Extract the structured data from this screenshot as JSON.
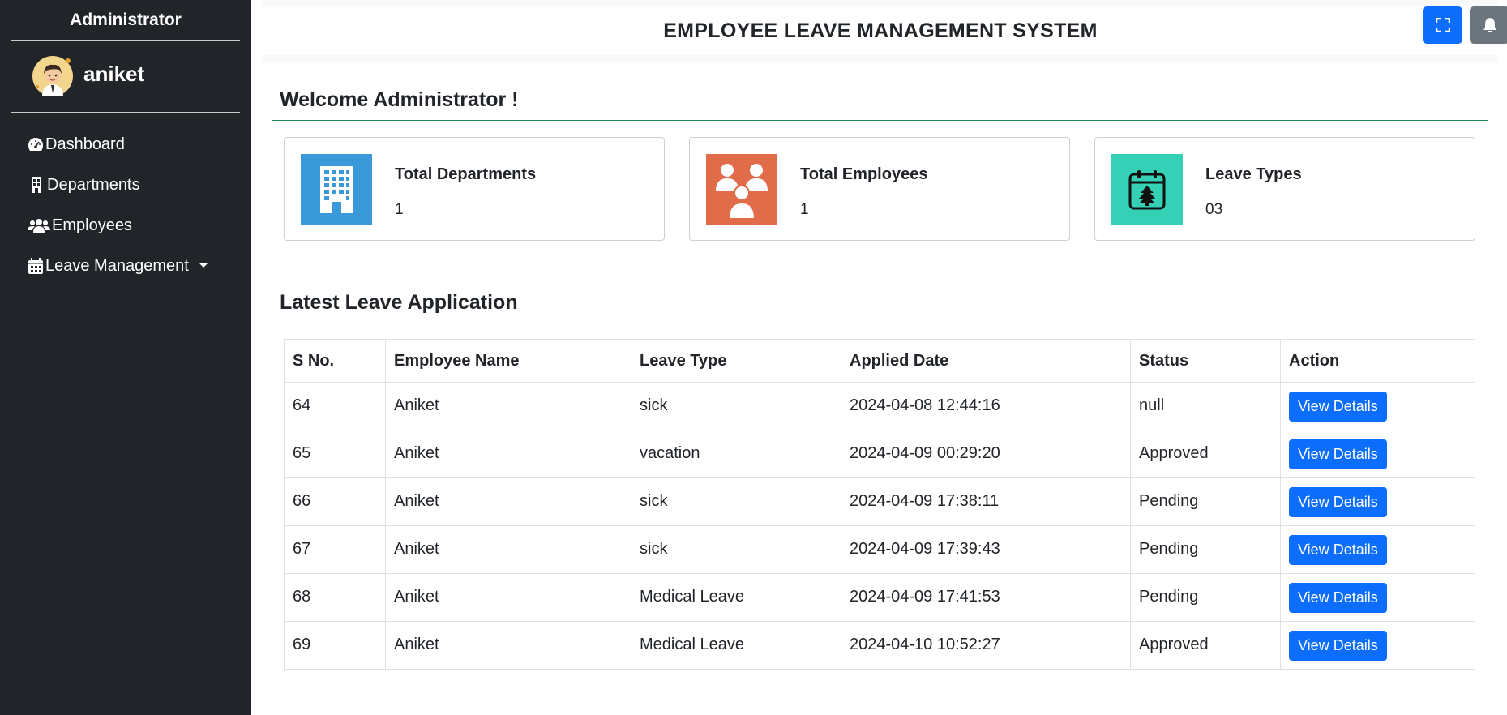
{
  "sidebar": {
    "role": "Administrator",
    "username": "aniket",
    "items": [
      {
        "label": "Dashboard",
        "icon": "dashboard-gauge-icon"
      },
      {
        "label": "Departments",
        "icon": "building-icon"
      },
      {
        "label": "Employees",
        "icon": "users-icon"
      },
      {
        "label": "Leave Management",
        "icon": "calendar-icon"
      }
    ]
  },
  "header": {
    "title": "EMPLOYEE LEAVE MANAGEMENT SYSTEM",
    "buttons": [
      {
        "name": "fullscreen-button",
        "icon": "expand-icon"
      },
      {
        "name": "notifications-button",
        "icon": "bell-icon"
      }
    ]
  },
  "welcome": {
    "title": "Welcome Administrator !"
  },
  "cards": [
    {
      "label": "Total Departments",
      "value": "1",
      "color": "#3a9ad9",
      "icon": "office-building-icon"
    },
    {
      "label": "Total Employees",
      "value": "1",
      "color": "#e06c4a",
      "icon": "employees-group-icon"
    },
    {
      "label": "Leave Types",
      "value": "03",
      "color": "#34d1b6",
      "icon": "calendar-tree-icon"
    }
  ],
  "latest": {
    "title": "Latest Leave Application",
    "columns": [
      "S No.",
      "Employee Name",
      "Leave Type",
      "Applied Date",
      "Status",
      "Action"
    ],
    "rows": [
      {
        "sno": "64",
        "name": "Aniket",
        "type": "sick",
        "date": "2024-04-08 12:44:16",
        "status": "null",
        "action": "View Details"
      },
      {
        "sno": "65",
        "name": "Aniket",
        "type": "vacation",
        "date": "2024-04-09 00:29:20",
        "status": "Approved",
        "action": "View Details"
      },
      {
        "sno": "66",
        "name": "Aniket",
        "type": "sick",
        "date": "2024-04-09 17:38:11",
        "status": "Pending",
        "action": "View Details"
      },
      {
        "sno": "67",
        "name": "Aniket",
        "type": "sick",
        "date": "2024-04-09 17:39:43",
        "status": "Pending",
        "action": "View Details"
      },
      {
        "sno": "68",
        "name": "Aniket",
        "type": "Medical Leave",
        "date": "2024-04-09 17:41:53",
        "status": "Pending",
        "action": "View Details"
      },
      {
        "sno": "69",
        "name": "Aniket",
        "type": "Medical Leave",
        "date": "2024-04-10 10:52:27",
        "status": "Approved",
        "action": "View Details"
      }
    ]
  },
  "colors": {
    "sidebar": "#212529",
    "primary": "#0d6efd",
    "secondary": "#6c757d",
    "divider": "#198754"
  }
}
